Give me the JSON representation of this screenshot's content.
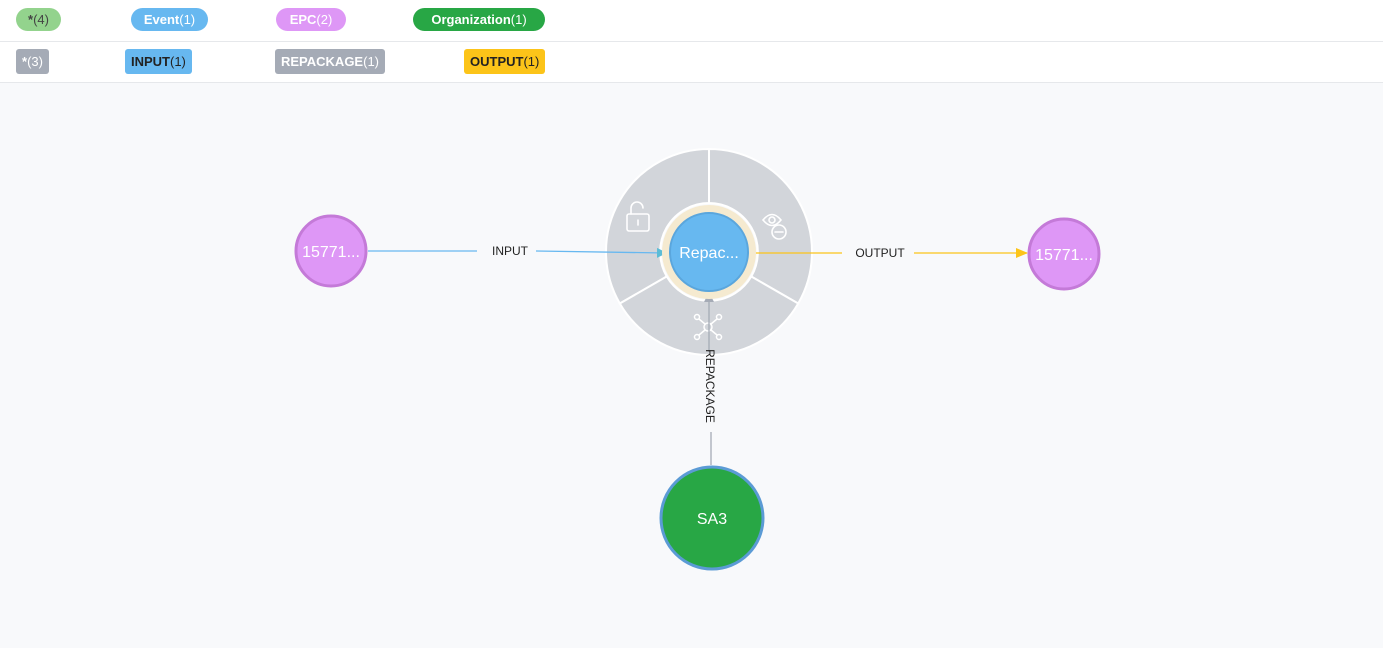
{
  "node_legend": [
    {
      "label": "*",
      "count": "(4)",
      "bg": "#93d38d",
      "fg": "#444444"
    },
    {
      "label": "Event",
      "count": "(1)",
      "bg": "#67b8f0",
      "fg": "#ffffff"
    },
    {
      "label": "EPC",
      "count": "(2)",
      "bg": "#de97f6",
      "fg": "#ffffff"
    },
    {
      "label": "Organization",
      "count": "(1)",
      "bg": "#28a745",
      "fg": "#ffffff"
    }
  ],
  "relationship_legend": [
    {
      "label": "*",
      "count": "(3)",
      "bg": "#a5abb6",
      "fg": "#ffffff"
    },
    {
      "label": "INPUT",
      "count": "(1)",
      "bg": "#67b8f0",
      "fg": "#222222"
    },
    {
      "label": "REPACKAGE",
      "count": "(1)",
      "bg": "#a5abb6",
      "fg": "#ffffff"
    },
    {
      "label": "OUTPUT",
      "count": "(1)",
      "bg": "#fcc419",
      "fg": "#222222"
    }
  ],
  "graph": {
    "nodes": {
      "epc_left": {
        "caption": "15771...",
        "color": "#de97f6",
        "border": "#c47ad8"
      },
      "event": {
        "caption": "Repac...",
        "color": "#67b8f0",
        "border": "#5aa6dd"
      },
      "epc_right": {
        "caption": "15771...",
        "color": "#de97f6",
        "border": "#c47ad8"
      },
      "org": {
        "caption": "SA3",
        "color": "#28a745",
        "border": "#5b9bd5"
      }
    },
    "relationships": {
      "input": {
        "label": "INPUT",
        "color": "#67b8f0"
      },
      "output": {
        "label": "OUTPUT",
        "color": "#fcc419"
      },
      "repackage": {
        "label": "REPACKAGE",
        "color": "#a5abb6"
      }
    },
    "ring_menu": {
      "items": [
        "unlock-icon",
        "hide-icon",
        "expand-icon"
      ],
      "color": "#d2d5da"
    }
  }
}
